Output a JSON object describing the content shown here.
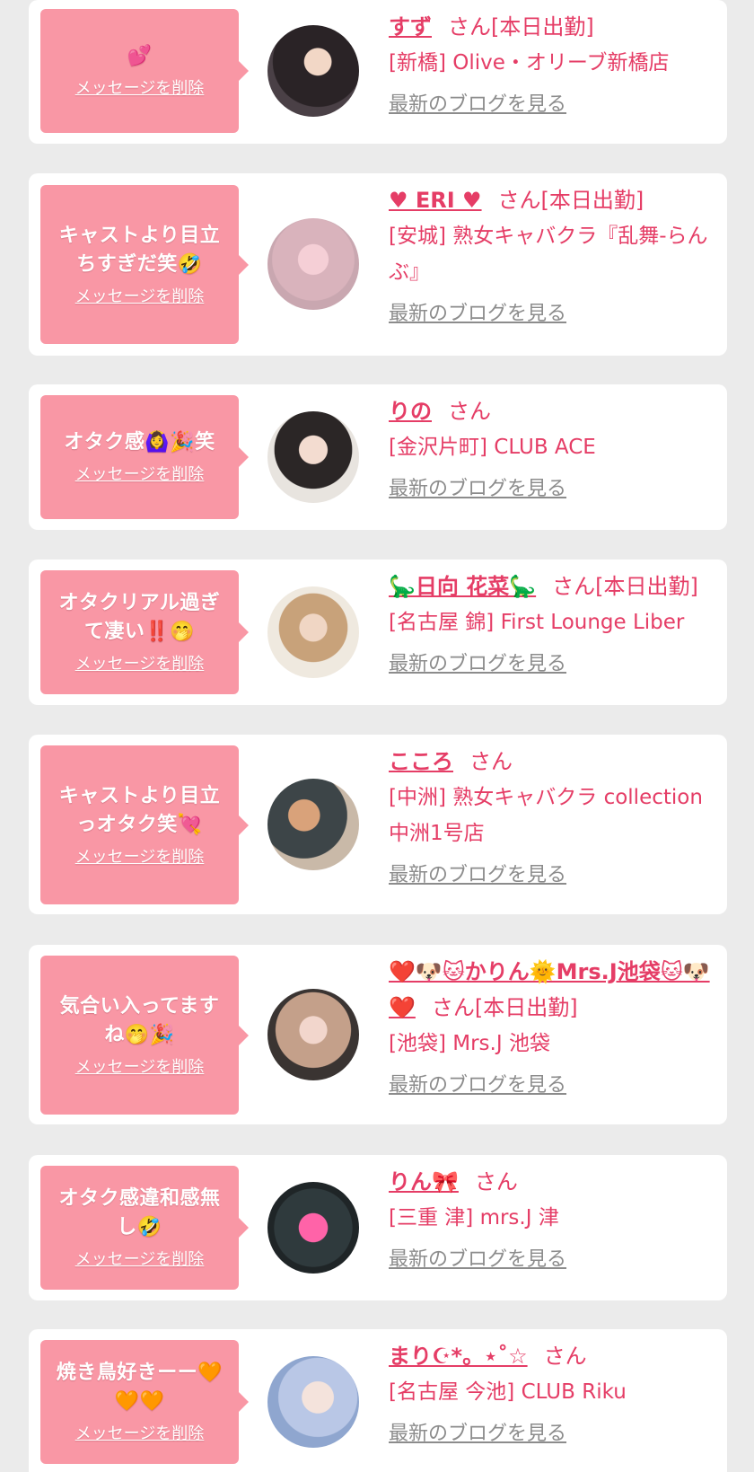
{
  "colors": {
    "background": "#ebebeb",
    "card": "#ffffff",
    "bubble": "#f997a5",
    "accent": "#e53d66",
    "link_gray": "#8c8c8c"
  },
  "common": {
    "delete_label": "メッセージを削除",
    "blog_label": "最新のブログを見る"
  },
  "cards": [
    {
      "message": "💕",
      "name": "すず",
      "suffix": "さん[本日出勤]",
      "shop": "[新橋] Olive・オリーブ新橋店"
    },
    {
      "message": "キャストより目立\nちすぎだ笑🤣",
      "name": "♥ ERI ♥",
      "suffix": "さん[本日出勤]",
      "shop": "[安城] 熟女キャバクラ『乱舞-らんぶ』"
    },
    {
      "message": "オタク感🙆‍♀️🎉笑",
      "name": "りの",
      "suffix": "さん",
      "shop": "[金沢片町] CLUB ACE"
    },
    {
      "message": "オタクリアル過ぎ\nて凄い‼️🤭",
      "name": "🦕日向 花菜🦕",
      "suffix": "さん[本日出勤]",
      "shop": "[名古屋 錦] First Lounge Liber"
    },
    {
      "message": "キャストより目立\nっオタク笑💘",
      "name": "こころ",
      "suffix": "さん",
      "shop": "[中洲] 熟女キャバクラ collection 中洲1号店"
    },
    {
      "message": "気合い入ってます\nね🤭🎉",
      "name": "❤️🐶🐱かりん🌞Mrs.J池袋🐱🐶❤️",
      "suffix": "さん[本日出勤]",
      "shop": "[池袋] Mrs.J 池袋"
    },
    {
      "message": "オタク感違和感無\nし🤣",
      "name": "りん🎀",
      "suffix": "さん",
      "shop": "[三重 津] mrs.J 津"
    },
    {
      "message": "焼き鳥好きーー🧡\n🧡🧡",
      "name": "まり☪*。⋆˚☆",
      "suffix": "さん",
      "shop": "[名古屋 今池] CLUB Riku"
    }
  ]
}
